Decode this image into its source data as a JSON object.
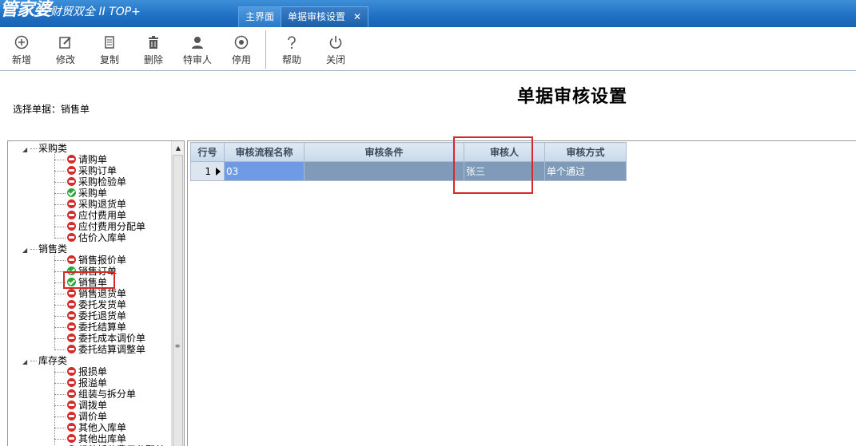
{
  "app": {
    "brand": "管家婆",
    "brand_sub": "财贸双全 II TOP+"
  },
  "tabs": [
    {
      "label": "主界面"
    },
    {
      "label": "单据审核设置",
      "close": "✕"
    }
  ],
  "toolbar": {
    "items": [
      {
        "label": "新增",
        "icon": "add-circle-icon"
      },
      {
        "label": "修改",
        "icon": "edit-icon"
      },
      {
        "label": "复制",
        "icon": "copy-icon"
      },
      {
        "label": "删除",
        "icon": "trash-icon"
      },
      {
        "label": "特审人",
        "icon": "user-icon"
      },
      {
        "label": "停用",
        "icon": "disable-circle-icon"
      },
      {
        "label": "帮助",
        "icon": "question-icon"
      },
      {
        "label": "关闭",
        "icon": "power-icon"
      }
    ]
  },
  "page": {
    "title": "单据审核设置",
    "doc_label": "选择单据：销售单"
  },
  "tree": {
    "categories": [
      {
        "label": "采购类",
        "toggle": "◢",
        "items": [
          {
            "label": "请购单",
            "status": "off"
          },
          {
            "label": "采购订单",
            "status": "off"
          },
          {
            "label": "采购检验单",
            "status": "off"
          },
          {
            "label": "采购单",
            "status": "on"
          },
          {
            "label": "采购退货单",
            "status": "off"
          },
          {
            "label": "应付费用单",
            "status": "off"
          },
          {
            "label": "应付费用分配单",
            "status": "off"
          },
          {
            "label": "估价入库单",
            "status": "off"
          }
        ]
      },
      {
        "label": "销售类",
        "toggle": "◢",
        "items": [
          {
            "label": "销售报价单",
            "status": "off"
          },
          {
            "label": "销售订单",
            "status": "on"
          },
          {
            "label": "销售单",
            "status": "on"
          },
          {
            "label": "销售退货单",
            "status": "off"
          },
          {
            "label": "委托发货单",
            "status": "off"
          },
          {
            "label": "委托退货单",
            "status": "off"
          },
          {
            "label": "委托结算单",
            "status": "off"
          },
          {
            "label": "委托成本调价单",
            "status": "off"
          },
          {
            "label": "委托结算调整单",
            "status": "off"
          }
        ]
      },
      {
        "label": "库存类",
        "toggle": "◢",
        "items": [
          {
            "label": "报损单",
            "status": "off"
          },
          {
            "label": "报溢单",
            "status": "off"
          },
          {
            "label": "组装与拆分单",
            "status": "off"
          },
          {
            "label": "调拨单",
            "status": "off"
          },
          {
            "label": "调价单",
            "status": "off"
          },
          {
            "label": "其他入库单",
            "status": "off"
          },
          {
            "label": "其他出库单",
            "status": "off"
          },
          {
            "label": "组装拆分费用分配单",
            "status": "off"
          }
        ]
      }
    ],
    "scroll_grip": "≡",
    "scroll_up": "▲"
  },
  "grid": {
    "headers": [
      "行号",
      "审核流程名称",
      "审核条件",
      "审核人",
      "审核方式"
    ],
    "rows": [
      {
        "num": "1",
        "flow": "03",
        "condition": "",
        "reviewer": "张三",
        "mode": "单个通过"
      }
    ]
  },
  "colors": {
    "accent": "#1f6fc3",
    "highlight": "#d62828",
    "row": "#7f9bb9",
    "selected_cell": "#6f9be6"
  }
}
